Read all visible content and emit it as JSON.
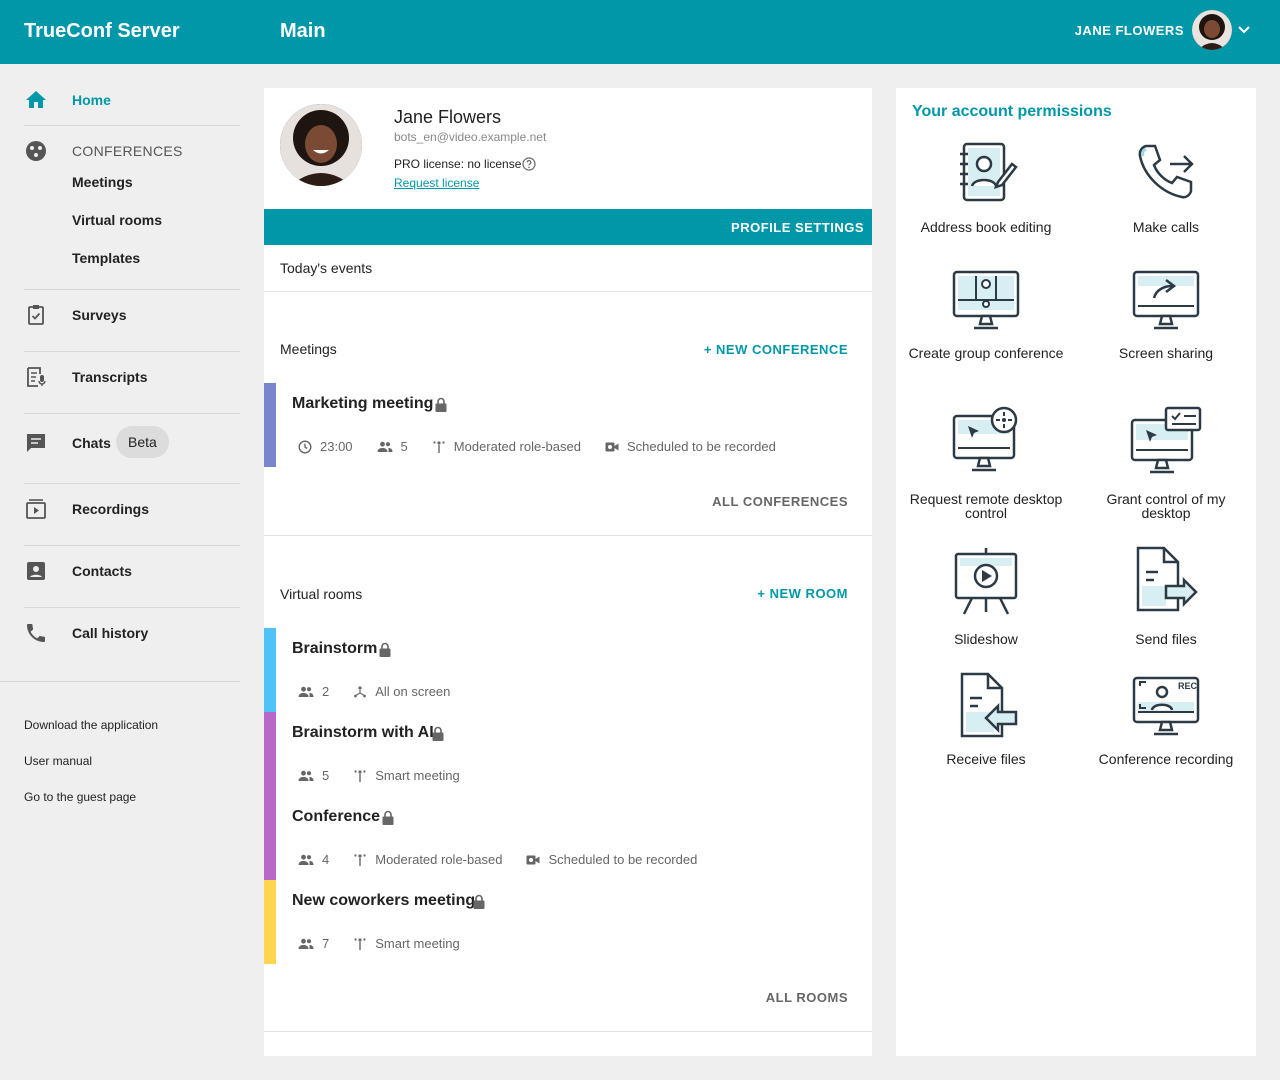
{
  "header": {
    "brand": "TrueConf Server",
    "page_title": "Main",
    "user_name": "JANE FLOWERS"
  },
  "sidebar": {
    "home": "Home",
    "conferences": "CONFERENCES",
    "meetings": "Meetings",
    "virtual_rooms": "Virtual rooms",
    "templates": "Templates",
    "surveys": "Surveys",
    "transcripts": "Transcripts",
    "chats": "Chats",
    "chats_badge": "Beta",
    "recordings": "Recordings",
    "contacts": "Contacts",
    "call_history": "Call history",
    "footer": {
      "download": "Download the application",
      "manual": "User manual",
      "guest": "Go to the guest page"
    }
  },
  "profile": {
    "name": "Jane Flowers",
    "email": "bots_en@video.example.net",
    "license": "PRO license: no license",
    "request_license": "Request license",
    "settings_button": "PROFILE SETTINGS"
  },
  "events": {
    "today": "Today's events",
    "meetings_title": "Meetings",
    "new_conference": "+ NEW CONFERENCE",
    "all_conferences": "ALL CONFERENCES",
    "meeting": {
      "name": "Marketing meeting",
      "time": "23:00",
      "participants": "5",
      "mode": "Moderated role-based",
      "recording": "Scheduled to be recorded",
      "color": "#7986cb"
    },
    "rooms_title": "Virtual rooms",
    "new_room": "+ NEW ROOM",
    "all_rooms": "ALL ROOMS",
    "rooms": [
      {
        "name": "Brainstorm",
        "participants": "2",
        "mode": "All on screen",
        "recording": "",
        "color": "#4fc3f7"
      },
      {
        "name": "Brainstorm with AI",
        "participants": "5",
        "mode": "Smart meeting",
        "recording": "",
        "color": "#ba68c8"
      },
      {
        "name": "Conference",
        "participants": "4",
        "mode": "Moderated role-based",
        "recording": "Scheduled to be recorded",
        "color": "#ba68c8"
      },
      {
        "name": "New coworkers meeting",
        "participants": "7",
        "mode": "Smart meeting",
        "recording": "",
        "color": "#ffd54f"
      }
    ]
  },
  "permissions": {
    "title": "Your account permissions",
    "items": [
      {
        "label": "Address book editing",
        "icon": "address-book-icon"
      },
      {
        "label": "Make calls",
        "icon": "phone-call-icon"
      },
      {
        "label": "Create group conference",
        "icon": "group-conference-icon"
      },
      {
        "label": "Screen sharing",
        "icon": "screen-share-icon"
      },
      {
        "label": "Request remote desktop control",
        "icon": "remote-control-icon"
      },
      {
        "label": "Grant control of my desktop",
        "icon": "grant-control-icon"
      },
      {
        "label": "Slideshow",
        "icon": "slideshow-icon"
      },
      {
        "label": "Send files",
        "icon": "send-file-icon"
      },
      {
        "label": "Receive files",
        "icon": "receive-file-icon"
      },
      {
        "label": "Conference recording",
        "icon": "recording-icon"
      }
    ]
  },
  "colors": {
    "accent": "#0098a8"
  }
}
